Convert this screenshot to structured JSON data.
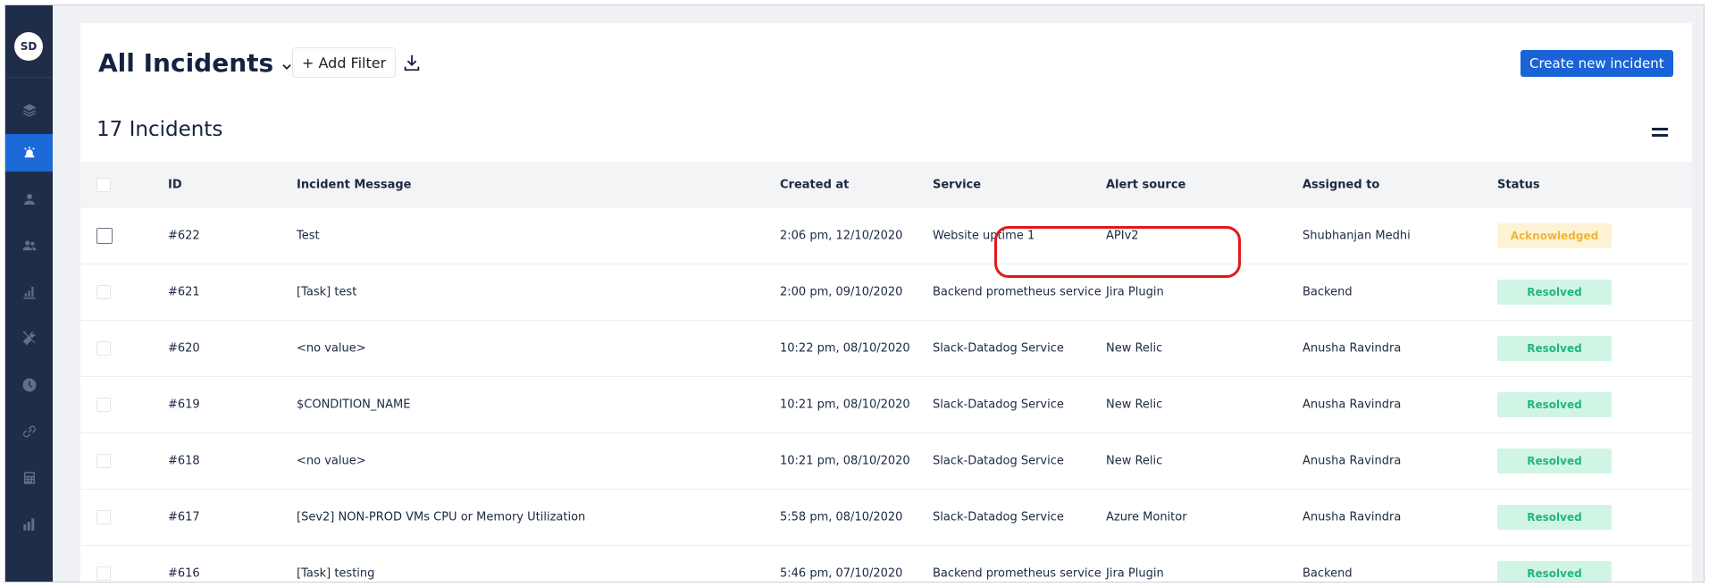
{
  "user": {
    "initials": "SD"
  },
  "sidebar": {
    "items": [
      {
        "icon": "layers-icon"
      },
      {
        "icon": "incident-siren-icon",
        "active": true
      },
      {
        "icon": "user-icon"
      },
      {
        "icon": "users-icon"
      },
      {
        "icon": "bar-chart-icon"
      },
      {
        "icon": "tools-icon"
      },
      {
        "icon": "clock-icon"
      },
      {
        "icon": "link-icon"
      },
      {
        "icon": "calculator-icon"
      },
      {
        "icon": "analytics-icon"
      }
    ]
  },
  "header": {
    "title": "All Incidents",
    "add_filter_label": "+ Add Filter",
    "download_icon": "download-icon",
    "create_label": "Create new incident"
  },
  "summary": {
    "count_label": "17 Incidents"
  },
  "table": {
    "columns": {
      "id": "ID",
      "message": "Incident Message",
      "created": "Created at",
      "service": "Service",
      "alert": "Alert source",
      "assigned": "Assigned to",
      "status": "Status"
    },
    "rows": [
      {
        "id": "#622",
        "message": "Test",
        "created": "2:06 pm, 12/10/2020",
        "service": "Website uptime 1",
        "alert": "APIv2",
        "assigned": "Shubhanjan Medhi",
        "status": "Acknowledged"
      },
      {
        "id": "#621",
        "message": "[Task] test",
        "created": "2:00 pm, 09/10/2020",
        "service": "Backend prometheus service",
        "alert": "Jira Plugin",
        "assigned": "Backend",
        "status": "Resolved"
      },
      {
        "id": "#620",
        "message": "<no value>",
        "created": "10:22 pm, 08/10/2020",
        "service": "Slack-Datadog Service",
        "alert": "New Relic",
        "assigned": "Anusha Ravindra",
        "status": "Resolved"
      },
      {
        "id": "#619",
        "message": "$CONDITION_NAME",
        "created": "10:21 pm, 08/10/2020",
        "service": "Slack-Datadog Service",
        "alert": "New Relic",
        "assigned": "Anusha Ravindra",
        "status": "Resolved"
      },
      {
        "id": "#618",
        "message": "<no value>",
        "created": "10:21 pm, 08/10/2020",
        "service": "Slack-Datadog Service",
        "alert": "New Relic",
        "assigned": "Anusha Ravindra",
        "status": "Resolved"
      },
      {
        "id": "#617",
        "message": "[Sev2] NON-PROD VMs CPU or Memory Utilization",
        "created": "5:58 pm, 08/10/2020",
        "service": "Slack-Datadog Service",
        "alert": "Azure Monitor",
        "assigned": "Anusha Ravindra",
        "status": "Resolved"
      },
      {
        "id": "#616",
        "message": "[Task] testing",
        "created": "5:46 pm, 07/10/2020",
        "service": "Backend prometheus service",
        "alert": "Jira Plugin",
        "assigned": "Backend",
        "status": "Resolved"
      }
    ]
  },
  "colors": {
    "sidebar_bg": "#1f2d48",
    "accent": "#1a63d6",
    "acknowledged": "#f0b53a",
    "resolved": "#1fb878",
    "highlight": "#e01919"
  }
}
